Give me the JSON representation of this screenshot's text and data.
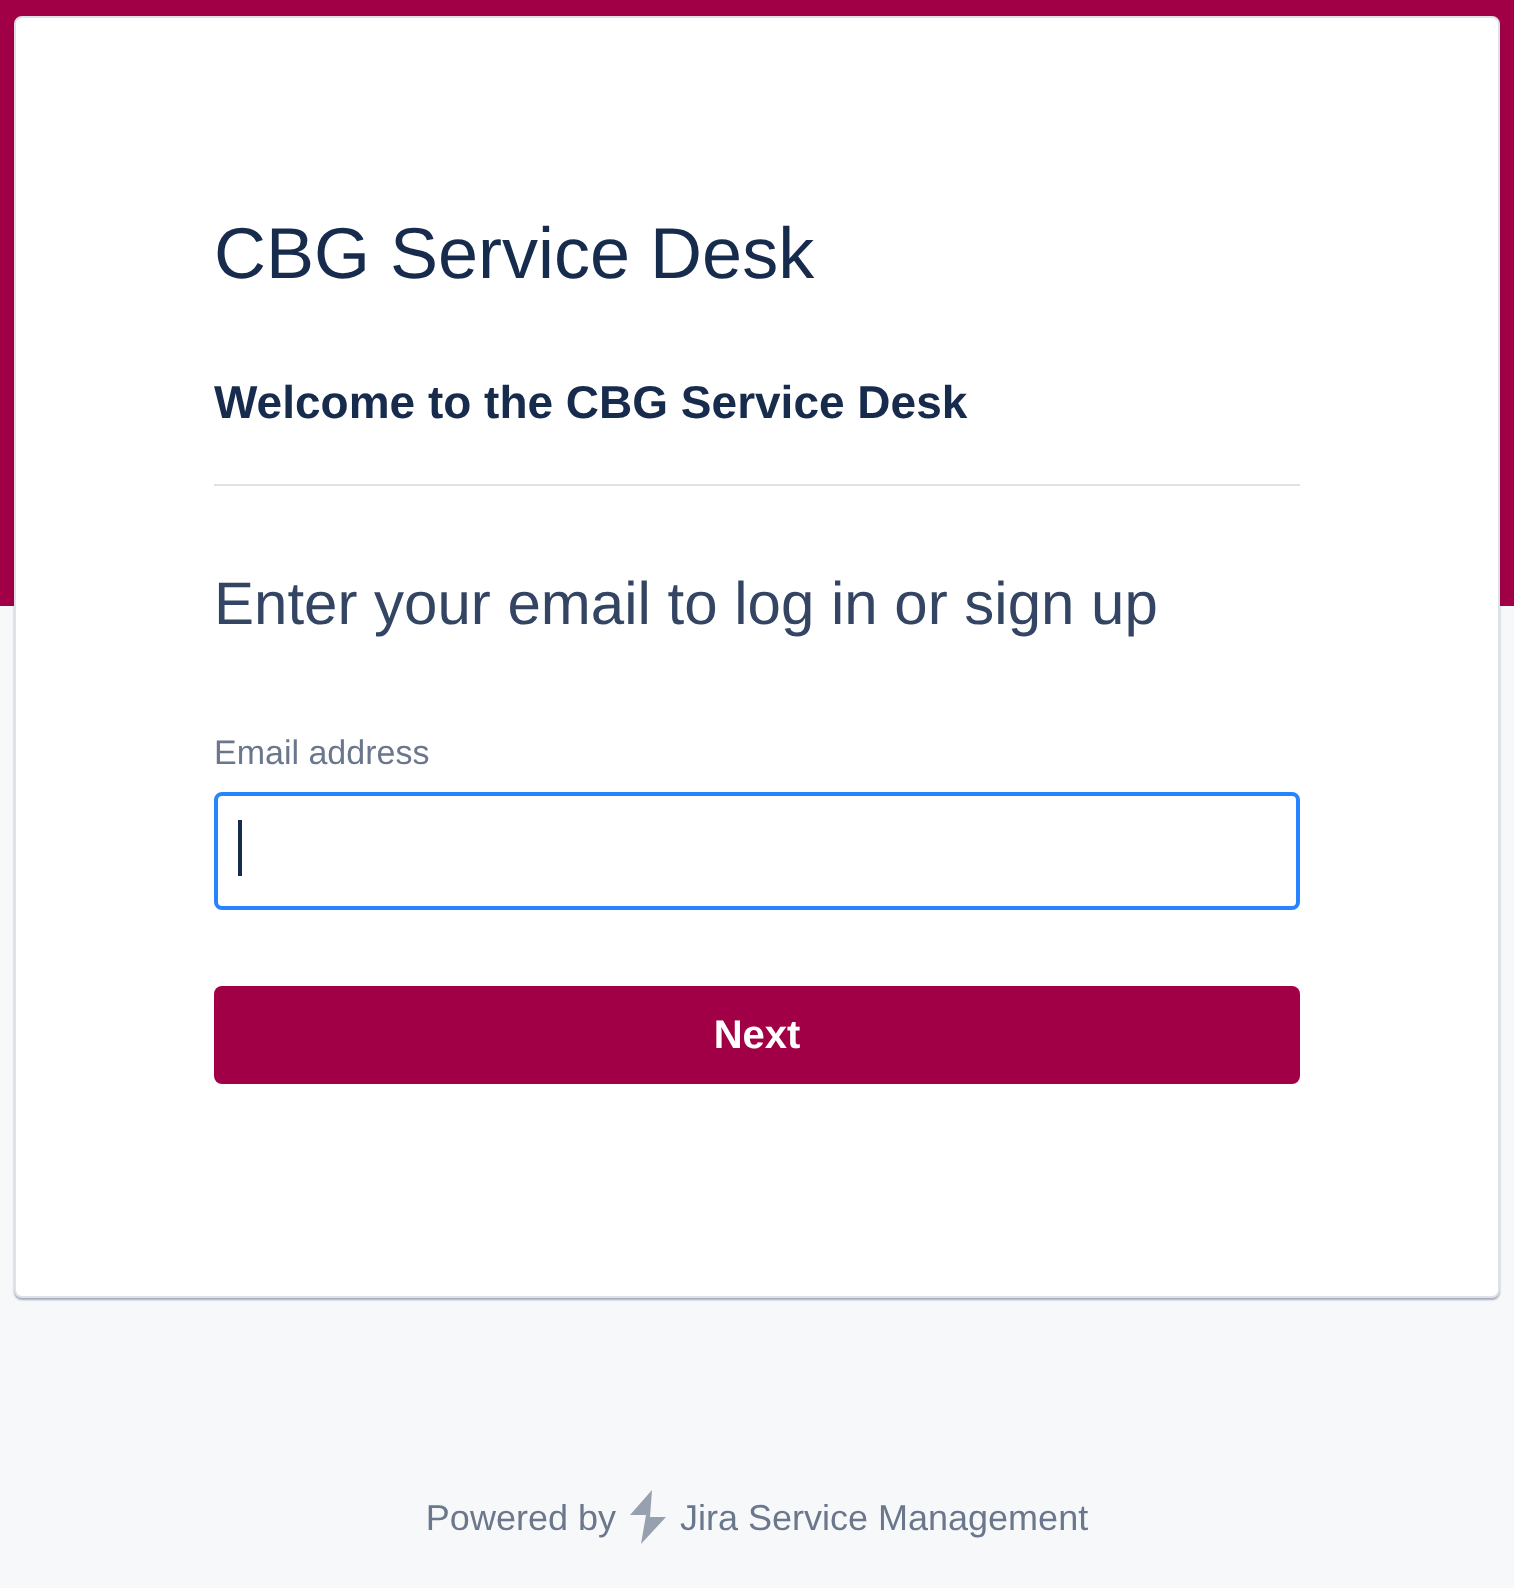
{
  "card": {
    "title": "CBG Service Desk",
    "subtitle": "Welcome to the CBG Service Desk",
    "prompt": "Enter your email to log in or sign up",
    "email_field": {
      "label": "Email address",
      "focused": true
    },
    "next_button": {
      "label": "Next"
    }
  },
  "footer": {
    "prefix": "Powered by",
    "product": "Jira Service Management"
  }
}
